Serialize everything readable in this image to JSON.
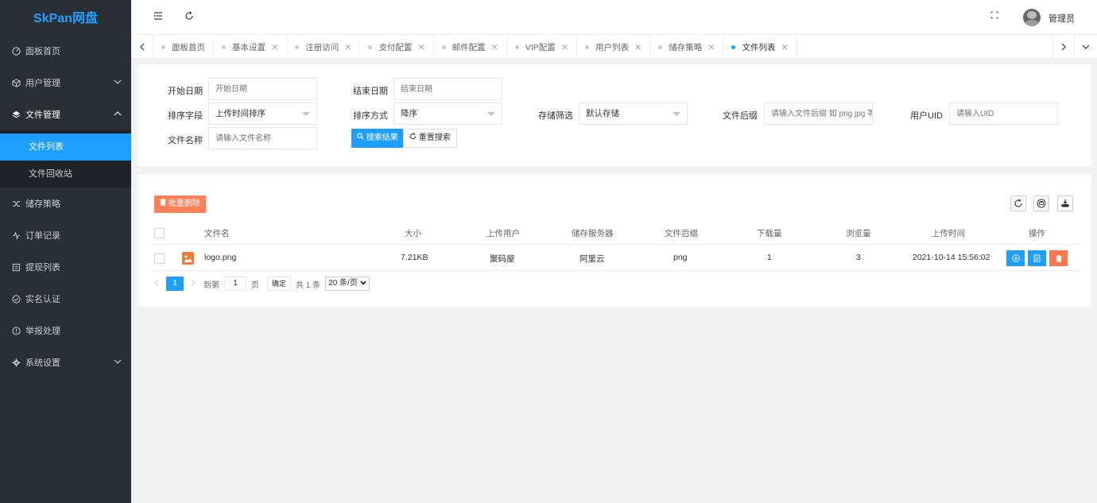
{
  "app": {
    "logo": "SkPan网盘"
  },
  "sidebar": {
    "items": [
      {
        "label": "面板首页"
      },
      {
        "label": "用户管理"
      },
      {
        "label": "文件管理"
      },
      {
        "label": "储存策略"
      },
      {
        "label": "订单记录"
      },
      {
        "label": "提现列表"
      },
      {
        "label": "实名认证"
      },
      {
        "label": "举报处理"
      },
      {
        "label": "系统设置"
      }
    ],
    "sub_items": [
      {
        "label": "文件列表"
      },
      {
        "label": "文件回收站"
      }
    ]
  },
  "header": {
    "admin_name": "管理员"
  },
  "tabs": [
    {
      "label": "面板首页"
    },
    {
      "label": "基本设置"
    },
    {
      "label": "注册访问"
    },
    {
      "label": "支付配置"
    },
    {
      "label": "邮件配置"
    },
    {
      "label": "VIP配置"
    },
    {
      "label": "用户列表"
    },
    {
      "label": "储存策略"
    },
    {
      "label": "文件列表"
    }
  ],
  "filter": {
    "start_date_label": "开始日期",
    "start_date_placeholder": "开始日期",
    "end_date_label": "结束日期",
    "end_date_placeholder": "结束日期",
    "sort_field_label": "排序字段",
    "sort_field_value": "上传时间排序",
    "sort_order_label": "排序方式",
    "sort_order_value": "降序",
    "storage_label": "存储筛选",
    "storage_value": "默认存储",
    "suffix_label": "文件后缀",
    "suffix_placeholder": "请输入文件后缀 如 png jpg 等",
    "uid_label": "用户UID",
    "uid_placeholder": "请输入UID",
    "name_label": "文件名称",
    "name_placeholder": "请输入文件名称",
    "search_button": "搜索结果",
    "reset_button": "重置搜索"
  },
  "table": {
    "batch_delete": "批量删除",
    "columns": {
      "name": "文件名",
      "size": "大小",
      "user": "上传用户",
      "server": "储存服务器",
      "suffix": "文件后缀",
      "downloads": "下载量",
      "views": "浏览量",
      "time": "上传时间",
      "ops": "操作"
    },
    "rows": [
      {
        "name": "logo.png",
        "size": "7.21KB",
        "user": "聚码屋",
        "server": "阿里云",
        "suffix": "png",
        "downloads": "1",
        "views": "3",
        "time": "2021-10-14 15:56:02"
      }
    ]
  },
  "pager": {
    "current": "1",
    "goto_label": "到第",
    "goto_value": "1",
    "page_unit": "页",
    "confirm": "确定",
    "total": "共 1 条",
    "page_size": "20 条/页"
  },
  "colors": {
    "primary": "#1e9fff",
    "danger": "#ff5722",
    "sidebar": "#2a2f36"
  }
}
